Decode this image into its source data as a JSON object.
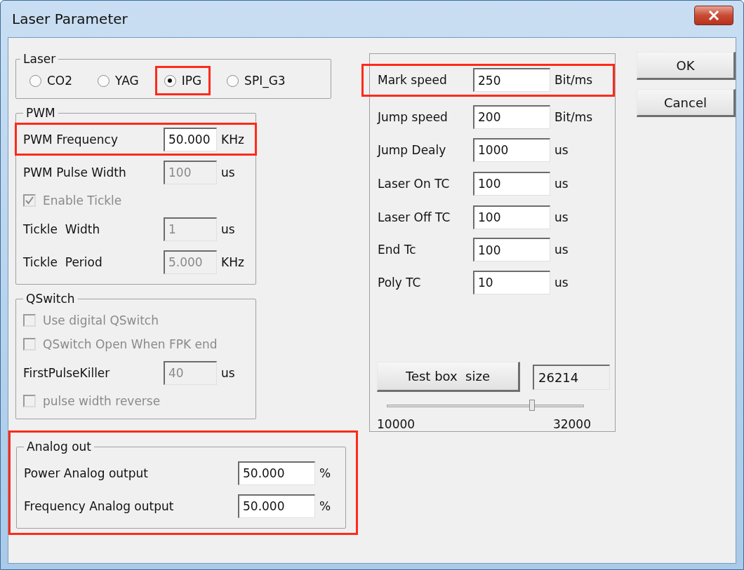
{
  "window": {
    "title": "Laser Parameter"
  },
  "laser": {
    "title": "Laser",
    "options": [
      {
        "label": "CO2",
        "selected": false,
        "highlighted": false
      },
      {
        "label": "YAG",
        "selected": false,
        "highlighted": false
      },
      {
        "label": "IPG",
        "selected": true,
        "highlighted": true
      },
      {
        "label": "SPI_G3",
        "selected": false,
        "highlighted": false
      }
    ]
  },
  "pwm": {
    "title": "PWM",
    "items": [
      {
        "kind": "field",
        "label": "PWM Frequency",
        "value": "50.000",
        "unit": "KHz",
        "disabled": false,
        "highlighted": true
      },
      {
        "kind": "field",
        "label": "PWM Pulse Width",
        "value": "100",
        "unit": "us",
        "disabled": true,
        "highlighted": false
      },
      {
        "kind": "checkbox",
        "label": "Enable Tickle",
        "checked": true,
        "disabled": true
      },
      {
        "kind": "field",
        "label": "Tickle  Width",
        "value": "1",
        "unit": "us",
        "disabled": true,
        "highlighted": false
      },
      {
        "kind": "field",
        "label": "Tickle  Period",
        "value": "5.000",
        "unit": "KHz",
        "disabled": true,
        "highlighted": false
      }
    ]
  },
  "qswitch": {
    "title": "QSwitch",
    "items": [
      {
        "kind": "checkbox",
        "label": "Use digital QSwitch",
        "checked": false,
        "disabled": true
      },
      {
        "kind": "checkbox",
        "label": "QSwitch Open When FPK end",
        "checked": false,
        "disabled": true
      },
      {
        "kind": "field",
        "label": "FirstPulseKiller",
        "value": "40",
        "unit": "us",
        "disabled": true,
        "highlighted": false
      },
      {
        "kind": "checkbox",
        "label": "pulse width reverse",
        "checked": false,
        "disabled": true
      }
    ]
  },
  "analog": {
    "title": "Analog out",
    "highlighted": true,
    "items": [
      {
        "kind": "field",
        "label": "Power Analog output",
        "value": "50.000",
        "unit": "%",
        "disabled": false,
        "highlighted": false
      },
      {
        "kind": "field",
        "label": "Frequency Analog output",
        "value": "50.000",
        "unit": "%",
        "disabled": false,
        "highlighted": false
      }
    ]
  },
  "speeds": {
    "items": [
      {
        "label": "Mark speed",
        "value": "250",
        "unit": "Bit/ms",
        "highlighted": true
      },
      {
        "label": "Jump speed",
        "value": "200",
        "unit": "Bit/ms",
        "highlighted": false
      },
      {
        "label": "Jump Dealy",
        "value": "1000",
        "unit": "us",
        "highlighted": false
      },
      {
        "label": "Laser On TC",
        "value": "100",
        "unit": "us",
        "highlighted": false
      },
      {
        "label": "Laser Off TC",
        "value": "100",
        "unit": "us",
        "highlighted": false
      },
      {
        "label": "End Tc",
        "value": "100",
        "unit": "us",
        "highlighted": false
      },
      {
        "label": "Poly TC",
        "value": "10",
        "unit": "us",
        "highlighted": false
      }
    ],
    "test_button": "Test box  size",
    "test_value": "26214",
    "slider": {
      "level": 0.74,
      "min_label": "10000",
      "max_label": "32000"
    }
  },
  "buttons": [
    "OK",
    "Cancel"
  ]
}
